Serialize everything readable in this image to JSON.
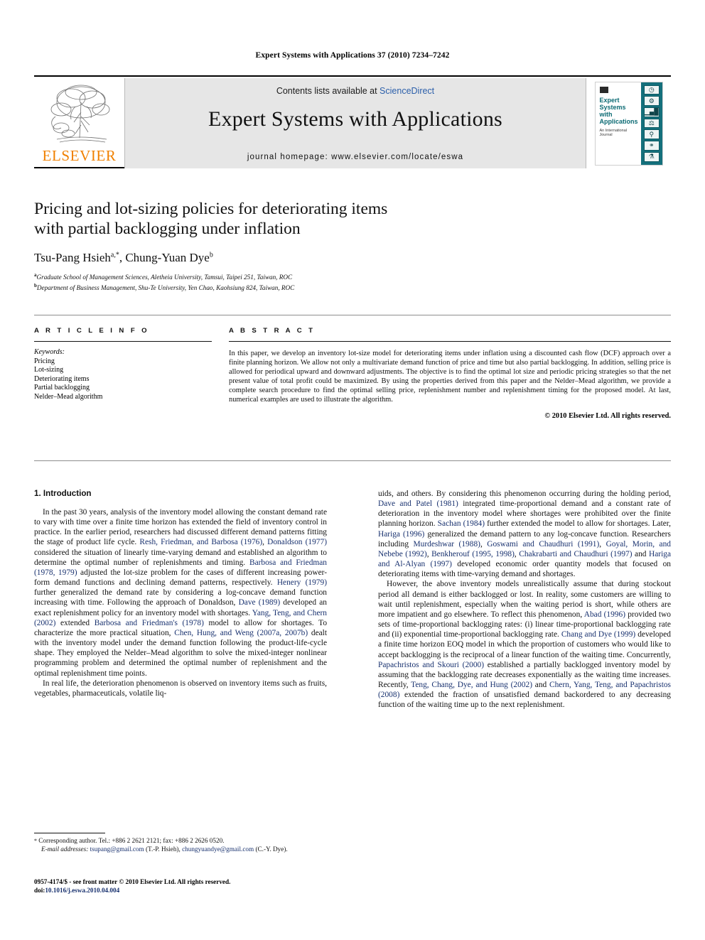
{
  "running_head": "Expert Systems with Applications 37 (2010) 7234–7242",
  "masthead": {
    "publisher_logo_label": "ELSEVIER",
    "contents_prefix": "Contents lists available at ",
    "contents_link": "ScienceDirect",
    "journal_title": "Expert Systems with Applications",
    "homepage": "journal homepage: www.elsevier.com/locate/eswa",
    "cover": {
      "title_lines": [
        "Expert",
        "Systems",
        "with",
        "Applications"
      ],
      "subtitle": "An International Journal",
      "icons": [
        "clock-icon",
        "gear-icon",
        "bar-chart-icon",
        "scales-icon",
        "microscope-icon",
        "network-icon",
        "flask-icon",
        "molecule-icon"
      ]
    }
  },
  "article": {
    "title_line1": "Pricing and lot-sizing policies for deteriorating items",
    "title_line2": "with partial backlogging under inflation",
    "authors": "Tsu-Pang Hsieh",
    "author1_sup": "a,*",
    "authors2": ", Chung-Yuan Dye",
    "author2_sup": "b",
    "affiliation_a_sup": "a",
    "affiliation_a": "Graduate School of Management Sciences, Aletheia University, Tamsui, Taipei 251, Taiwan, ROC",
    "affiliation_b_sup": "b",
    "affiliation_b": "Department of Business Management, Shu-Te University, Yen Chao, Kaohsiung 824, Taiwan, ROC"
  },
  "article_info": {
    "heading": "A R T I C L E  I N F O",
    "keywords_label": "Keywords:",
    "keywords": [
      "Pricing",
      "Lot-sizing",
      "Deteriorating items",
      "Partial backlogging",
      "Nelder–Mead algorithm"
    ]
  },
  "abstract": {
    "heading": "A B S T R A C T",
    "body": "In this paper, we develop an inventory lot-size model for deteriorating items under inflation using a discounted cash flow (DCF) approach over a finite planning horizon. We allow not only a multivariate demand function of price and time but also partial backlogging. In addition, selling price is allowed for periodical upward and downward adjustments. The objective is to find the optimal lot size and periodic pricing strategies so that the net present value of total profit could be maximized. By using the properties derived from this paper and the Nelder–Mead algorithm, we provide a complete search procedure to find the optimal selling price, replenishment number and replenishment timing for the proposed model. At last, numerical examples are used to illustrate the algorithm.",
    "copyright": "© 2010 Elsevier Ltd. All rights reserved."
  },
  "body": {
    "section_heading": "1. Introduction",
    "left_paragraphs": [
      [
        {
          "t": "In the past 30 years, analysis of the inventory model allowing the constant demand rate to vary with time over a finite time horizon has extended the field of inventory control in practice. In the earlier period, researchers had discussed different demand patterns fitting the stage of product life cycle. ",
          "c": false
        },
        {
          "t": "Resh, Friedman, and Barbosa (1976)",
          "c": true
        },
        {
          "t": ", ",
          "c": false
        },
        {
          "t": "Donaldson (1977)",
          "c": true
        },
        {
          "t": " considered the situation of linearly time-varying demand and established an algorithm to determine the optimal number of replenishments and timing. ",
          "c": false
        },
        {
          "t": "Barbosa and Friedman (1978, 1979)",
          "c": true
        },
        {
          "t": " adjusted the lot-size problem for the cases of different increasing power-form demand functions and declining demand patterns, respectively. ",
          "c": false
        },
        {
          "t": "Henery (1979)",
          "c": true
        },
        {
          "t": " further generalized the demand rate by considering a log-concave demand function increasing with time. Following the approach of Donaldson, ",
          "c": false
        },
        {
          "t": "Dave (1989)",
          "c": true
        },
        {
          "t": " developed an exact replenishment policy for an inventory model with shortages. ",
          "c": false
        },
        {
          "t": "Yang, Teng, and Chern (2002)",
          "c": true
        },
        {
          "t": " extended ",
          "c": false
        },
        {
          "t": "Barbosa and Friedman's (1978)",
          "c": true
        },
        {
          "t": " model to allow for shortages. To characterize the more practical situation, ",
          "c": false
        },
        {
          "t": "Chen, Hung, and Weng (2007a, 2007b)",
          "c": true
        },
        {
          "t": " dealt with the inventory model under the demand function following the product-life-cycle shape. They employed the Nelder–Mead algorithm to solve the mixed-integer nonlinear programming problem and determined the optimal number of replenishment and the optimal replenishment time points.",
          "c": false
        }
      ],
      [
        {
          "t": "In real life, the deterioration phenomenon is observed on inventory items such as fruits, vegetables, pharmaceuticals, volatile liq-",
          "c": false
        }
      ]
    ],
    "right_paragraphs": [
      [
        {
          "t": "uids, and others. By considering this phenomenon occurring during the holding period, ",
          "c": false
        },
        {
          "t": "Dave and Patel (1981)",
          "c": true
        },
        {
          "t": " integrated time-proportional demand and a constant rate of deterioration in the inventory model where shortages were prohibited over the finite planning horizon. ",
          "c": false
        },
        {
          "t": "Sachan (1984)",
          "c": true
        },
        {
          "t": " further extended the model to allow for shortages. Later, ",
          "c": false
        },
        {
          "t": "Hariga (1996)",
          "c": true
        },
        {
          "t": " generalized the demand pattern to any log-concave function. Researchers including ",
          "c": false
        },
        {
          "t": "Murdeshwar (1988)",
          "c": true
        },
        {
          "t": ", ",
          "c": false
        },
        {
          "t": "Goswami and Chaudhuri (1991)",
          "c": true
        },
        {
          "t": ", ",
          "c": false
        },
        {
          "t": "Goyal, Morin, and Nebebe (1992)",
          "c": true
        },
        {
          "t": ", ",
          "c": false
        },
        {
          "t": "Benkherouf (1995, 1998)",
          "c": true
        },
        {
          "t": ", ",
          "c": false
        },
        {
          "t": "Chakrabarti and Chaudhuri (1997)",
          "c": true
        },
        {
          "t": " and ",
          "c": false
        },
        {
          "t": "Hariga and Al-Alyan (1997)",
          "c": true
        },
        {
          "t": " developed economic order quantity models that focused on deteriorating items with time-varying demand and shortages.",
          "c": false
        }
      ],
      [
        {
          "t": "However, the above inventory models unrealistically assume that during stockout period all demand is either backlogged or lost. In reality, some customers are willing to wait until replenishment, especially when the waiting period is short, while others are more impatient and go elsewhere. To reflect this phenomenon, ",
          "c": false
        },
        {
          "t": "Abad (1996)",
          "c": true
        },
        {
          "t": " provided two sets of time-proportional backlogging rates: (i) linear time-proportional backlogging rate and (ii) exponential time-proportional backlogging rate. ",
          "c": false
        },
        {
          "t": "Chang and Dye (1999)",
          "c": true
        },
        {
          "t": " developed a finite time horizon EOQ model in which the proportion of customers who would like to accept backlogging is the reciprocal of a linear function of the waiting time. Concurrently, ",
          "c": false
        },
        {
          "t": "Papachristos and Skouri (2000)",
          "c": true
        },
        {
          "t": " established a partially backlogged inventory model by assuming that the backlogging rate decreases exponentially as the waiting time increases. Recently, ",
          "c": false
        },
        {
          "t": "Teng, Chang, Dye, and Hung (2002)",
          "c": true
        },
        {
          "t": " and ",
          "c": false
        },
        {
          "t": "Chern, Yang, Teng, and Papachristos (2008)",
          "c": true
        },
        {
          "t": " extended the fraction of unsatisfied demand backordered to any decreasing function of the waiting time up to the next replenishment.",
          "c": false
        }
      ]
    ]
  },
  "footnote": {
    "star": "*",
    "corresponding": " Corresponding author. Tel.: +886 2 2621 2121; fax: +886 2 2626 0520.",
    "email_label": "E-mail addresses:",
    "email1": "tsupang@gmail.com",
    "email1_owner": " (T.-P. Hsieh), ",
    "email2": "chungyuandye@gmail.com",
    "email2_owner": " (C.-Y. Dye)."
  },
  "imprint": {
    "line1": "0957-4174/$ - see front matter © 2010 Elsevier Ltd. All rights reserved.",
    "doi_label": "doi:",
    "doi": "10.1016/j.eswa.2010.04.004"
  }
}
